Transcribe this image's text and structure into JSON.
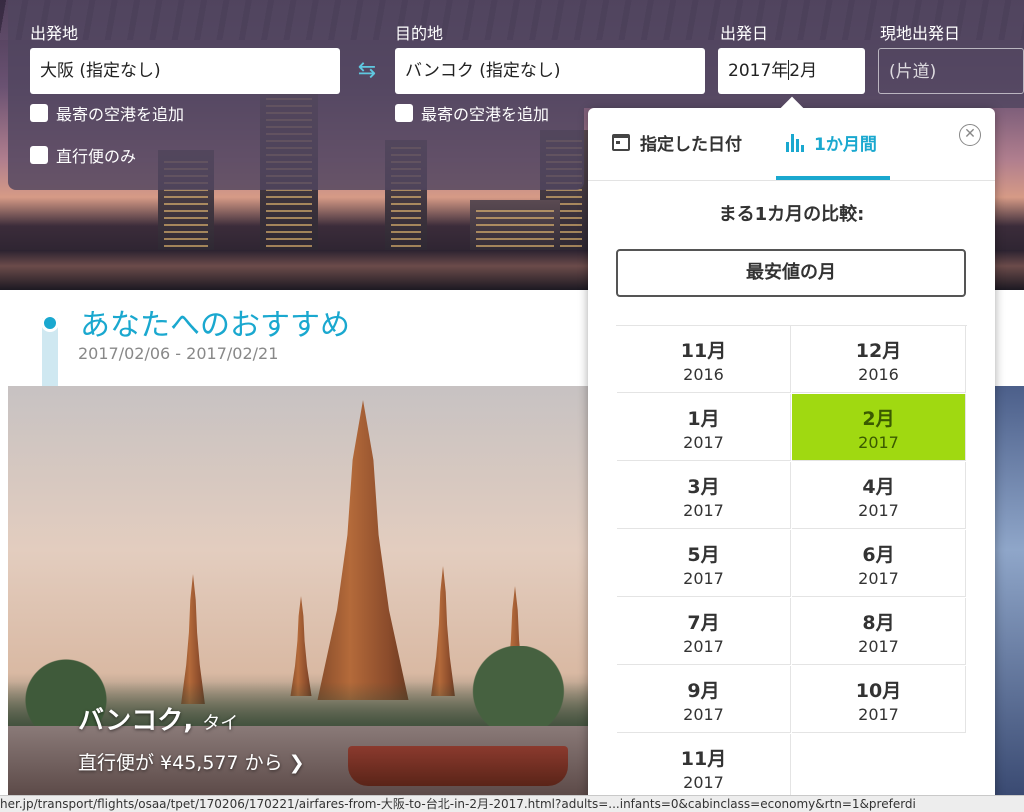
{
  "search": {
    "origin_label": "出発地",
    "origin_value": "大阪 (指定なし)",
    "destination_label": "目的地",
    "destination_value": "バンコク (指定なし)",
    "depart_label": "出発日",
    "depart_value_before_caret": "2017年",
    "depart_value_after_caret": "2月",
    "return_label": "現地出発日",
    "return_value": "(片道)",
    "nearby_origin": "最寄の空港を追加",
    "nearby_destination": "最寄の空港を追加",
    "direct_only": "直行便のみ"
  },
  "recommendations": {
    "title": "あなたへのおすすめ",
    "dates": "2017/02/06 - 2017/02/21",
    "card": {
      "city": "バンコク",
      "country": "タイ",
      "price_text": "直行便が ¥45,577 から",
      "arrow": "❯"
    }
  },
  "date_popup": {
    "tab_specific": "指定した日付",
    "tab_month": "1か月間",
    "close_glyph": "✕",
    "compare_title": "まる1カ月の比較:",
    "cheapest_month": "最安値の月",
    "months": [
      {
        "month": "11月",
        "year": "2016"
      },
      {
        "month": "12月",
        "year": "2016"
      },
      {
        "month": "1月",
        "year": "2017"
      },
      {
        "month": "2月",
        "year": "2017",
        "selected": true
      },
      {
        "month": "3月",
        "year": "2017"
      },
      {
        "month": "4月",
        "year": "2017"
      },
      {
        "month": "5月",
        "year": "2017"
      },
      {
        "month": "6月",
        "year": "2017"
      },
      {
        "month": "7月",
        "year": "2017"
      },
      {
        "month": "8月",
        "year": "2017"
      },
      {
        "month": "9月",
        "year": "2017"
      },
      {
        "month": "10月",
        "year": "2017"
      },
      {
        "month": "11月",
        "year": "2017"
      }
    ]
  },
  "status_bar": {
    "url": "her.jp/transport/flights/osaa/tpet/170206/170221/airfares-from-大阪-to-台北-in-2月-2017.html?adults=...infants=0&cabinclass=economy&rtn=1&preferdi"
  },
  "colors": {
    "accent": "#1aa8cf",
    "selected_month": "#a0d911"
  },
  "icons": [
    "swap-arrows-icon",
    "calendar-icon",
    "bar-chart-icon",
    "close-icon",
    "chevron-right-icon"
  ]
}
